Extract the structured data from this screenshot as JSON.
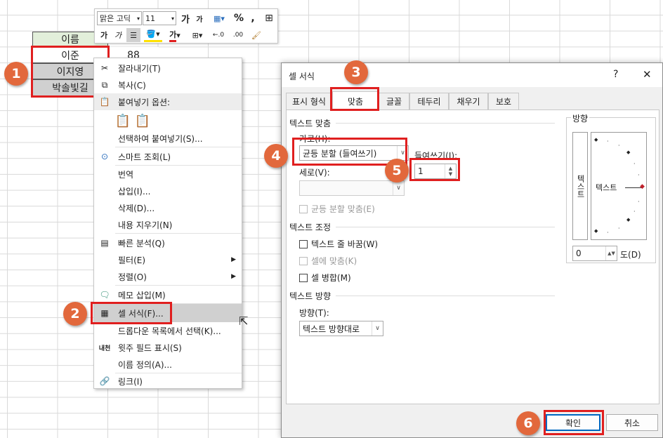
{
  "sheet": {
    "header": "이름",
    "rows": [
      "이준",
      "이지영",
      "박솔빛길"
    ],
    "value": "88"
  },
  "mini_toolbar": {
    "font": "맑은 고딕",
    "size": "11",
    "grow": "가",
    "shrink": "가",
    "percent": "%",
    "comma": ",",
    "dec_inc": "←.0",
    "dec_dec": ".00"
  },
  "context_menu": {
    "cut": "잘라내기(T)",
    "copy": "복사(C)",
    "paste_options": "붙여넣기 옵션:",
    "paste_special": "선택하여 붙여넣기(S)...",
    "smart_lookup": "스마트 조회(L)",
    "translate": "번역",
    "insert": "삽입(I)...",
    "delete": "삭제(D)...",
    "clear": "내용 지우기(N)",
    "quick_analysis": "빠른 분석(Q)",
    "filter": "필터(E)",
    "sort": "정렬(O)",
    "insert_memo": "메모 삽입(M)",
    "format_cells": "셀 서식(F)...",
    "pick_list": "드롭다운 목록에서 선택(K)...",
    "phonetic": "윗주 필드 표시(S)",
    "define_name": "이름 정의(A)...",
    "link": "링크(I)",
    "phonetic_icon": "내천"
  },
  "dialog": {
    "title": "셀 서식",
    "help": "?",
    "close": "✕",
    "tabs": [
      "표시 형식",
      "맞춤",
      "글꼴",
      "테두리",
      "채우기",
      "보호"
    ],
    "text_align": "텍스트 맞춤",
    "horizontal": "가로(H):",
    "horizontal_value": "균등 분할 (들여쓰기)",
    "indent": "들여쓰기(I):",
    "indent_value": "1",
    "vertical": "세로(V):",
    "vertical_value": "",
    "justify_distributed": "균등 분할 맞춤(E)",
    "text_control": "텍스트 조정",
    "wrap": "텍스트 줄 바꿈(W)",
    "shrink": "셀에 맞춤(K)",
    "merge": "셀 병합(M)",
    "direction_group": "텍스트 방향",
    "direction": "방향(T):",
    "direction_value": "텍스트 방향대로",
    "orientation": "방향",
    "vertical_text": "텍스트",
    "orient_text": "텍스트",
    "degrees_value": "0",
    "degrees_label": "도(D)",
    "ok": "확인",
    "cancel": "취소"
  },
  "badges": [
    "1",
    "2",
    "3",
    "4",
    "5",
    "6"
  ],
  "colors": {
    "highlight": "#e01f1f",
    "badge": "#e2683c"
  }
}
